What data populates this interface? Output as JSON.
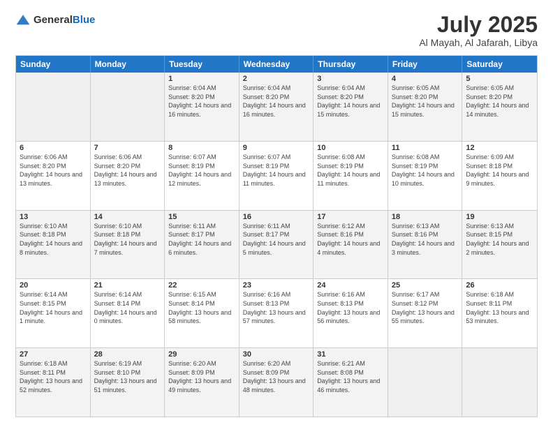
{
  "header": {
    "logo_general": "General",
    "logo_blue": "Blue",
    "month": "July 2025",
    "location": "Al Mayah, Al Jafarah, Libya"
  },
  "weekdays": [
    "Sunday",
    "Monday",
    "Tuesday",
    "Wednesday",
    "Thursday",
    "Friday",
    "Saturday"
  ],
  "rows": [
    [
      {
        "day": "",
        "info": "",
        "empty": true
      },
      {
        "day": "",
        "info": "",
        "empty": true
      },
      {
        "day": "1",
        "info": "Sunrise: 6:04 AM\nSunset: 8:20 PM\nDaylight: 14 hours and 16 minutes."
      },
      {
        "day": "2",
        "info": "Sunrise: 6:04 AM\nSunset: 8:20 PM\nDaylight: 14 hours and 16 minutes."
      },
      {
        "day": "3",
        "info": "Sunrise: 6:04 AM\nSunset: 8:20 PM\nDaylight: 14 hours and 15 minutes."
      },
      {
        "day": "4",
        "info": "Sunrise: 6:05 AM\nSunset: 8:20 PM\nDaylight: 14 hours and 15 minutes."
      },
      {
        "day": "5",
        "info": "Sunrise: 6:05 AM\nSunset: 8:20 PM\nDaylight: 14 hours and 14 minutes."
      }
    ],
    [
      {
        "day": "6",
        "info": "Sunrise: 6:06 AM\nSunset: 8:20 PM\nDaylight: 14 hours and 13 minutes."
      },
      {
        "day": "7",
        "info": "Sunrise: 6:06 AM\nSunset: 8:20 PM\nDaylight: 14 hours and 13 minutes."
      },
      {
        "day": "8",
        "info": "Sunrise: 6:07 AM\nSunset: 8:19 PM\nDaylight: 14 hours and 12 minutes."
      },
      {
        "day": "9",
        "info": "Sunrise: 6:07 AM\nSunset: 8:19 PM\nDaylight: 14 hours and 11 minutes."
      },
      {
        "day": "10",
        "info": "Sunrise: 6:08 AM\nSunset: 8:19 PM\nDaylight: 14 hours and 11 minutes."
      },
      {
        "day": "11",
        "info": "Sunrise: 6:08 AM\nSunset: 8:19 PM\nDaylight: 14 hours and 10 minutes."
      },
      {
        "day": "12",
        "info": "Sunrise: 6:09 AM\nSunset: 8:18 PM\nDaylight: 14 hours and 9 minutes."
      }
    ],
    [
      {
        "day": "13",
        "info": "Sunrise: 6:10 AM\nSunset: 8:18 PM\nDaylight: 14 hours and 8 minutes."
      },
      {
        "day": "14",
        "info": "Sunrise: 6:10 AM\nSunset: 8:18 PM\nDaylight: 14 hours and 7 minutes."
      },
      {
        "day": "15",
        "info": "Sunrise: 6:11 AM\nSunset: 8:17 PM\nDaylight: 14 hours and 6 minutes."
      },
      {
        "day": "16",
        "info": "Sunrise: 6:11 AM\nSunset: 8:17 PM\nDaylight: 14 hours and 5 minutes."
      },
      {
        "day": "17",
        "info": "Sunrise: 6:12 AM\nSunset: 8:16 PM\nDaylight: 14 hours and 4 minutes."
      },
      {
        "day": "18",
        "info": "Sunrise: 6:13 AM\nSunset: 8:16 PM\nDaylight: 14 hours and 3 minutes."
      },
      {
        "day": "19",
        "info": "Sunrise: 6:13 AM\nSunset: 8:15 PM\nDaylight: 14 hours and 2 minutes."
      }
    ],
    [
      {
        "day": "20",
        "info": "Sunrise: 6:14 AM\nSunset: 8:15 PM\nDaylight: 14 hours and 1 minute."
      },
      {
        "day": "21",
        "info": "Sunrise: 6:14 AM\nSunset: 8:14 PM\nDaylight: 14 hours and 0 minutes."
      },
      {
        "day": "22",
        "info": "Sunrise: 6:15 AM\nSunset: 8:14 PM\nDaylight: 13 hours and 58 minutes."
      },
      {
        "day": "23",
        "info": "Sunrise: 6:16 AM\nSunset: 8:13 PM\nDaylight: 13 hours and 57 minutes."
      },
      {
        "day": "24",
        "info": "Sunrise: 6:16 AM\nSunset: 8:13 PM\nDaylight: 13 hours and 56 minutes."
      },
      {
        "day": "25",
        "info": "Sunrise: 6:17 AM\nSunset: 8:12 PM\nDaylight: 13 hours and 55 minutes."
      },
      {
        "day": "26",
        "info": "Sunrise: 6:18 AM\nSunset: 8:11 PM\nDaylight: 13 hours and 53 minutes."
      }
    ],
    [
      {
        "day": "27",
        "info": "Sunrise: 6:18 AM\nSunset: 8:11 PM\nDaylight: 13 hours and 52 minutes."
      },
      {
        "day": "28",
        "info": "Sunrise: 6:19 AM\nSunset: 8:10 PM\nDaylight: 13 hours and 51 minutes."
      },
      {
        "day": "29",
        "info": "Sunrise: 6:20 AM\nSunset: 8:09 PM\nDaylight: 13 hours and 49 minutes."
      },
      {
        "day": "30",
        "info": "Sunrise: 6:20 AM\nSunset: 8:09 PM\nDaylight: 13 hours and 48 minutes."
      },
      {
        "day": "31",
        "info": "Sunrise: 6:21 AM\nSunset: 8:08 PM\nDaylight: 13 hours and 46 minutes."
      },
      {
        "day": "",
        "info": "",
        "empty": true
      },
      {
        "day": "",
        "info": "",
        "empty": true
      }
    ]
  ],
  "alt_rows": [
    0,
    2,
    4
  ]
}
